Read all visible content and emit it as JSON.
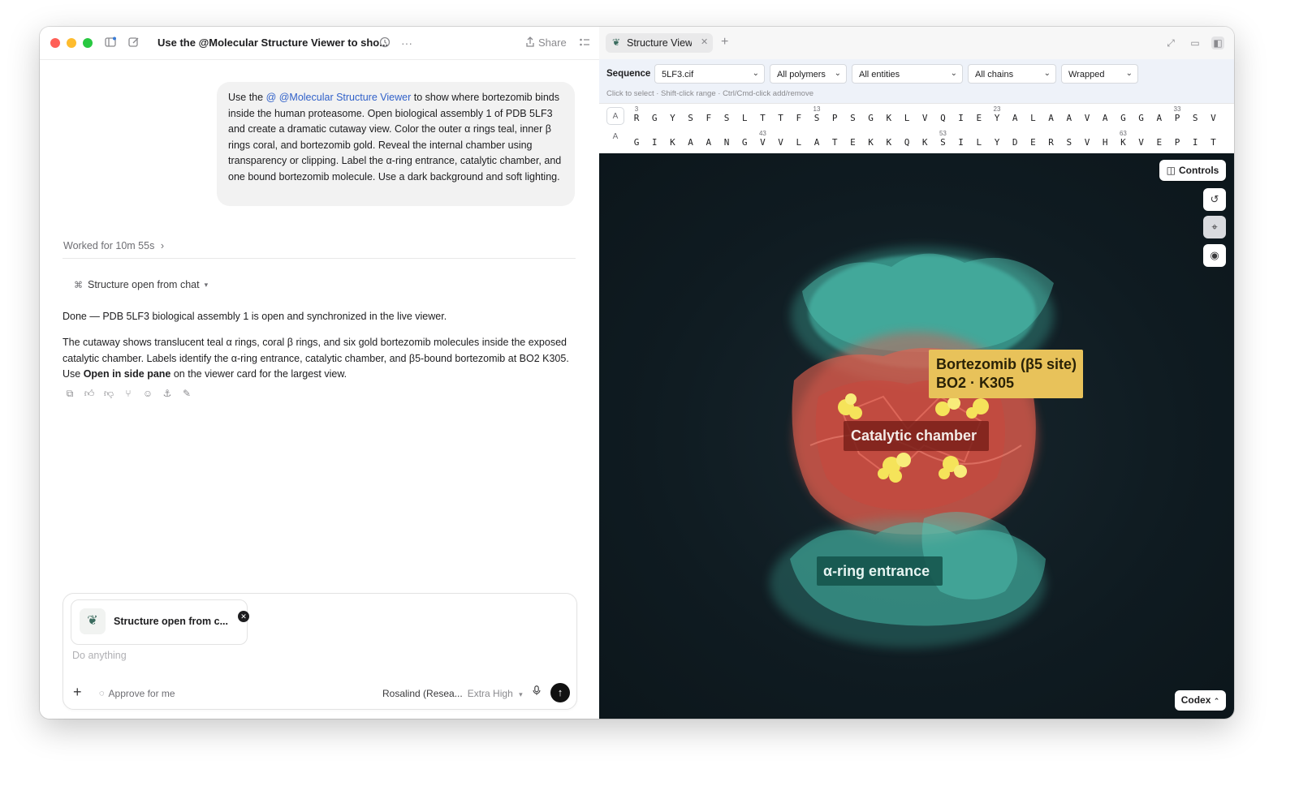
{
  "chat": {
    "title": "Use the @Molecular Structure Viewer to sho...",
    "share_label": "Share",
    "user_message": {
      "before": "Use the ",
      "mention": "@ @Molecular Structure Viewer",
      "after": " to show where bortezomib binds inside the human proteasome. Open biological assembly 1 of PDB 5LF3 and create a dramatic cutaway view. Color the outer α rings teal, inner β rings coral, and bortezomib gold. Reveal the internal chamber using transparency or clipping. Label the α-ring entrance, catalytic chamber, and one bound bortezomib molecule. Use a dark background and soft lighting."
    },
    "worked_for": "Worked for 10m 55s",
    "structure_chip": "Structure open from chat",
    "reply_p1": "Done — PDB 5LF3 biological assembly 1 is open and synchronized in the live viewer.",
    "reply_p2": "The cutaway shows translucent teal α rings, coral β rings, and six gold bortezomib molecules inside the exposed catalytic chamber. Labels identify the α-ring entrance, catalytic chamber, and β5-bound bortezomib at BO2 K305.",
    "reply_p3_before": "Use ",
    "reply_p3_bold": "Open in side pane",
    "reply_p3_after": " on the viewer card for the largest view."
  },
  "composer": {
    "attachment_label": "Structure open from c...",
    "placeholder": "Do anything",
    "approve_label": "Approve for me",
    "model": "Rosalind (Resea...",
    "effort": "Extra High"
  },
  "viewer": {
    "tab_label": "Structure View",
    "sequence_label": "Sequence",
    "selects": [
      "5LF3.cif",
      "All polymers",
      "All entities",
      "All chains",
      "Wrapped"
    ],
    "hint": "Click to select · Shift-click range · Ctrl/Cmd-click add/remove",
    "row1": {
      "chain": "A",
      "residues": [
        "R",
        "G",
        "Y",
        "S",
        "F",
        "S",
        "L",
        "T",
        "T",
        "F",
        "S",
        "P",
        "S",
        "G",
        "K",
        "L",
        "V",
        "Q",
        "I",
        "E",
        "Y",
        "A",
        "L",
        "A",
        "A",
        "V",
        "A",
        "G",
        "G",
        "A",
        "P",
        "S",
        "V"
      ],
      "numbers": [
        {
          "i": 0,
          "n": "3"
        },
        {
          "i": 10,
          "n": "13"
        },
        {
          "i": 20,
          "n": "23"
        },
        {
          "i": 30,
          "n": "33"
        }
      ]
    },
    "row2": {
      "chain": "A",
      "residues": [
        "G",
        "I",
        "K",
        "A",
        "A",
        "N",
        "G",
        "V",
        "V",
        "L",
        "A",
        "T",
        "E",
        "K",
        "K",
        "Q",
        "K",
        "S",
        "I",
        "L",
        "Y",
        "D",
        "E",
        "R",
        "S",
        "V",
        "H",
        "K",
        "V",
        "E",
        "P",
        "I",
        "T"
      ],
      "numbers": [
        {
          "i": 7,
          "n": "43"
        },
        {
          "i": 17,
          "n": "53"
        },
        {
          "i": 27,
          "n": "63"
        }
      ]
    },
    "controls_label": "Controls",
    "codex_label": "Codex",
    "label_bortezomib_1": "Bortezomib (β5 site)",
    "label_bortezomib_2": "BO2 · K305",
    "label_chamber": "Catalytic chamber",
    "label_entrance": "α-ring entrance",
    "colors": {
      "alpha_rings": "#3fb3a3",
      "beta_rings": "#e2574c",
      "bortezomib": "#f5e35a",
      "background": "#0f1b21"
    }
  }
}
